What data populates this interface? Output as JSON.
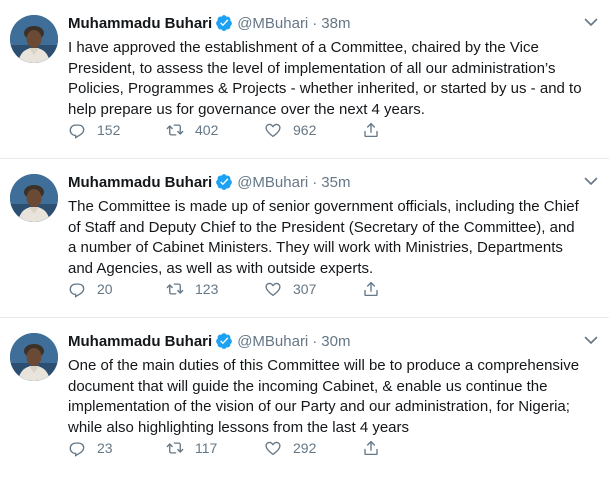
{
  "tweets": [
    {
      "author_name": "Muhammadu Buhari",
      "handle": "@MBuhari",
      "separator": "·",
      "time": "38m",
      "text": "I have approved the establishment of a Committee, chaired by the Vice President, to assess the level of implementation of all our administration’s Policies, Programmes & Projects - whether inherited, or started by us - and to help prepare us for governance over the next 4 years.",
      "replies": "152",
      "retweets": "402",
      "likes": "962"
    },
    {
      "author_name": "Muhammadu Buhari",
      "handle": "@MBuhari",
      "separator": "·",
      "time": "35m",
      "text": "The Committee is made up of senior government officials, including the Chief of Staff and Deputy Chief to the President (Secretary of the Committee), and a number of Cabinet Ministers. They will work with Ministries, Departments and Agencies, as well as with outside experts.",
      "replies": "20",
      "retweets": "123",
      "likes": "307"
    },
    {
      "author_name": "Muhammadu Buhari",
      "handle": "@MBuhari",
      "separator": "·",
      "time": "30m",
      "text": "One of the main duties of this Committee will be to produce a comprehensive document that will guide the incoming Cabinet, & enable us continue the implementation of the vision of our Party and our administration, for Nigeria; while also highlighting lessons from the last 4 years",
      "replies": "23",
      "retweets": "117",
      "likes": "292"
    }
  ],
  "icons": {
    "verified": "verified-badge-icon",
    "reply": "reply-icon",
    "retweet": "retweet-icon",
    "like": "heart-icon",
    "share": "share-icon",
    "menu": "chevron-down-icon"
  },
  "colors": {
    "verified": "#1da1f2",
    "secondary_text": "#657786",
    "primary_text": "#14171a"
  }
}
